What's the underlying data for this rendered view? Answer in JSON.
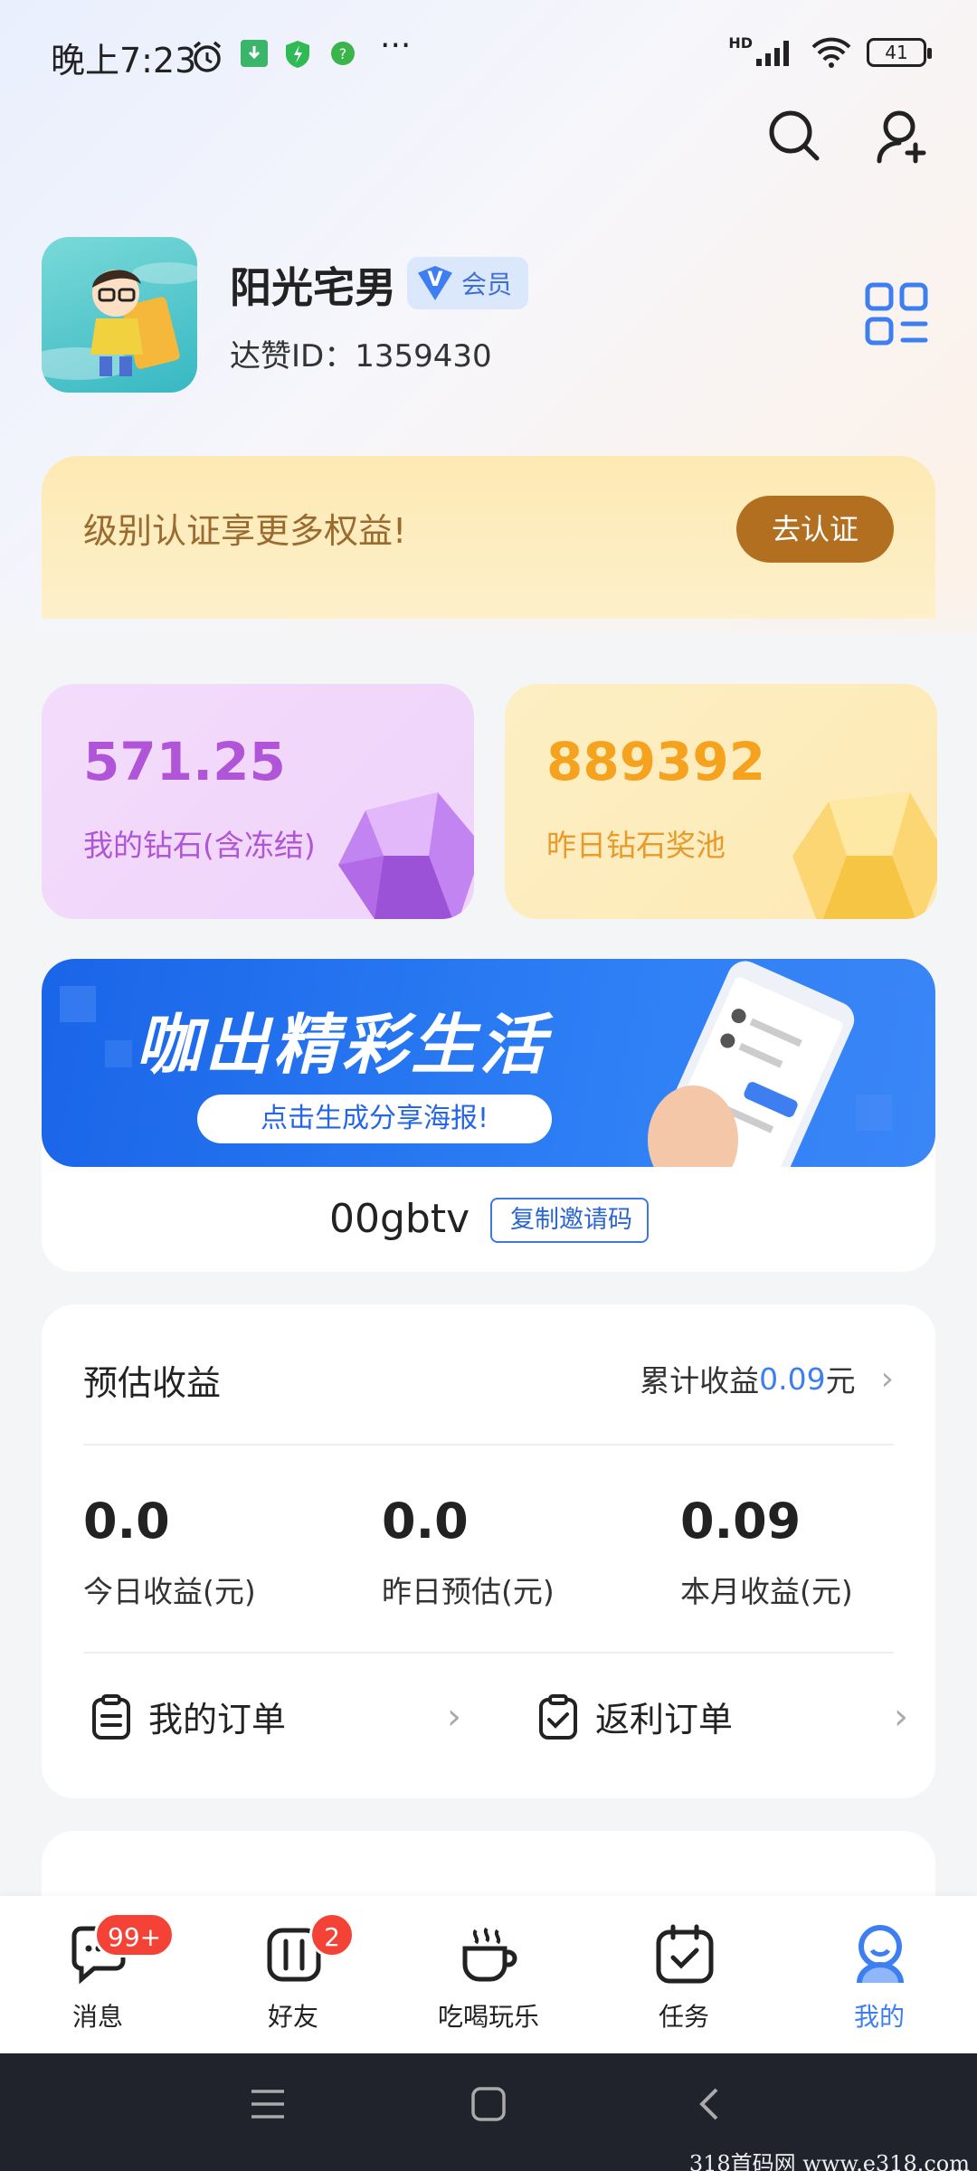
{
  "status_bar": {
    "time": "晚上7:23",
    "more": "···",
    "network": "HD",
    "battery": "41"
  },
  "header": {
    "search_icon": "search-icon",
    "add_user_icon": "add-user-icon"
  },
  "profile": {
    "name": "阳光宅男",
    "vip_label": "会员",
    "id_text": "达赞ID：1359430",
    "qr_icon": "qr-code-icon"
  },
  "cert_banner": {
    "text": "级别认证享更多权益!",
    "button": "去认证"
  },
  "stats": {
    "diamonds": {
      "value": "571.25",
      "label": "我的钻石(含冻结)"
    },
    "pool": {
      "value": "889392",
      "label": "昨日钻石奖池"
    }
  },
  "invite": {
    "promo_title": "咖出精彩生活",
    "promo_button": "点击生成分享海报!",
    "code": "00gbtv",
    "copy_label": "复制邀请码"
  },
  "earnings": {
    "title": "预估收益",
    "total_prefix": "累计收益",
    "total_value": "0.09",
    "total_suffix": "元",
    "items": [
      {
        "value": "0.0",
        "label": "今日收益(元)"
      },
      {
        "value": "0.0",
        "label": "昨日预估(元)"
      },
      {
        "value": "0.09",
        "label": "本月收益(元)"
      }
    ],
    "my_orders": "我的订单",
    "rebate_orders": "返利订单"
  },
  "tabs": [
    {
      "label": "消息",
      "badge": "99+",
      "icon": "message-icon"
    },
    {
      "label": "好友",
      "badge": "2",
      "icon": "friends-icon"
    },
    {
      "label": "吃喝玩乐",
      "icon": "cup-icon"
    },
    {
      "label": "任务",
      "icon": "task-icon"
    },
    {
      "label": "我的",
      "icon": "profile-icon",
      "active": true
    }
  ],
  "watermark": "318首码网 www.e318.com",
  "colors": {
    "accent": "#3d7ff0",
    "badge": "#f44336",
    "diamond": "#b054d8",
    "pool": "#f5a21f",
    "cert_button": "#b16f1f"
  }
}
